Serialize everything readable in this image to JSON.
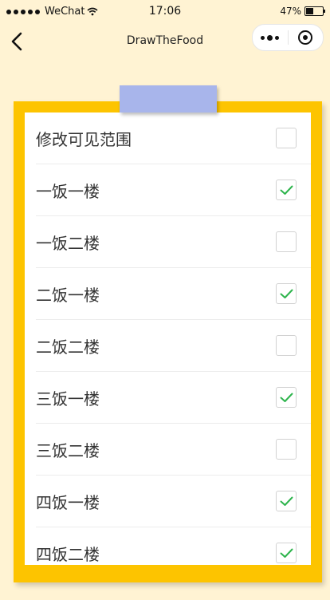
{
  "status_bar": {
    "carrier": "WeChat",
    "time": "17:06",
    "battery": "47%",
    "battery_level": 0.47,
    "icons": [
      "signal-dots",
      "wifi-icon",
      "battery-icon"
    ]
  },
  "nav": {
    "title": "DrawTheFood",
    "back_icon": "chevron-left-icon",
    "more_icon": "more-dots-icon",
    "close_icon": "target-close-icon"
  },
  "colors": {
    "background": "#fff3d3",
    "board": "#fdc400",
    "tape": "#a8b5eb",
    "check": "#2db44c"
  },
  "options": [
    {
      "label": "修改可见范围",
      "checked": false
    },
    {
      "label": "一饭一楼",
      "checked": true
    },
    {
      "label": "一饭二楼",
      "checked": false
    },
    {
      "label": "二饭一楼",
      "checked": true
    },
    {
      "label": "二饭二楼",
      "checked": false
    },
    {
      "label": "三饭一楼",
      "checked": true
    },
    {
      "label": "三饭二楼",
      "checked": false
    },
    {
      "label": "四饭一楼",
      "checked": true
    },
    {
      "label": "四饭二楼",
      "checked": true
    }
  ]
}
